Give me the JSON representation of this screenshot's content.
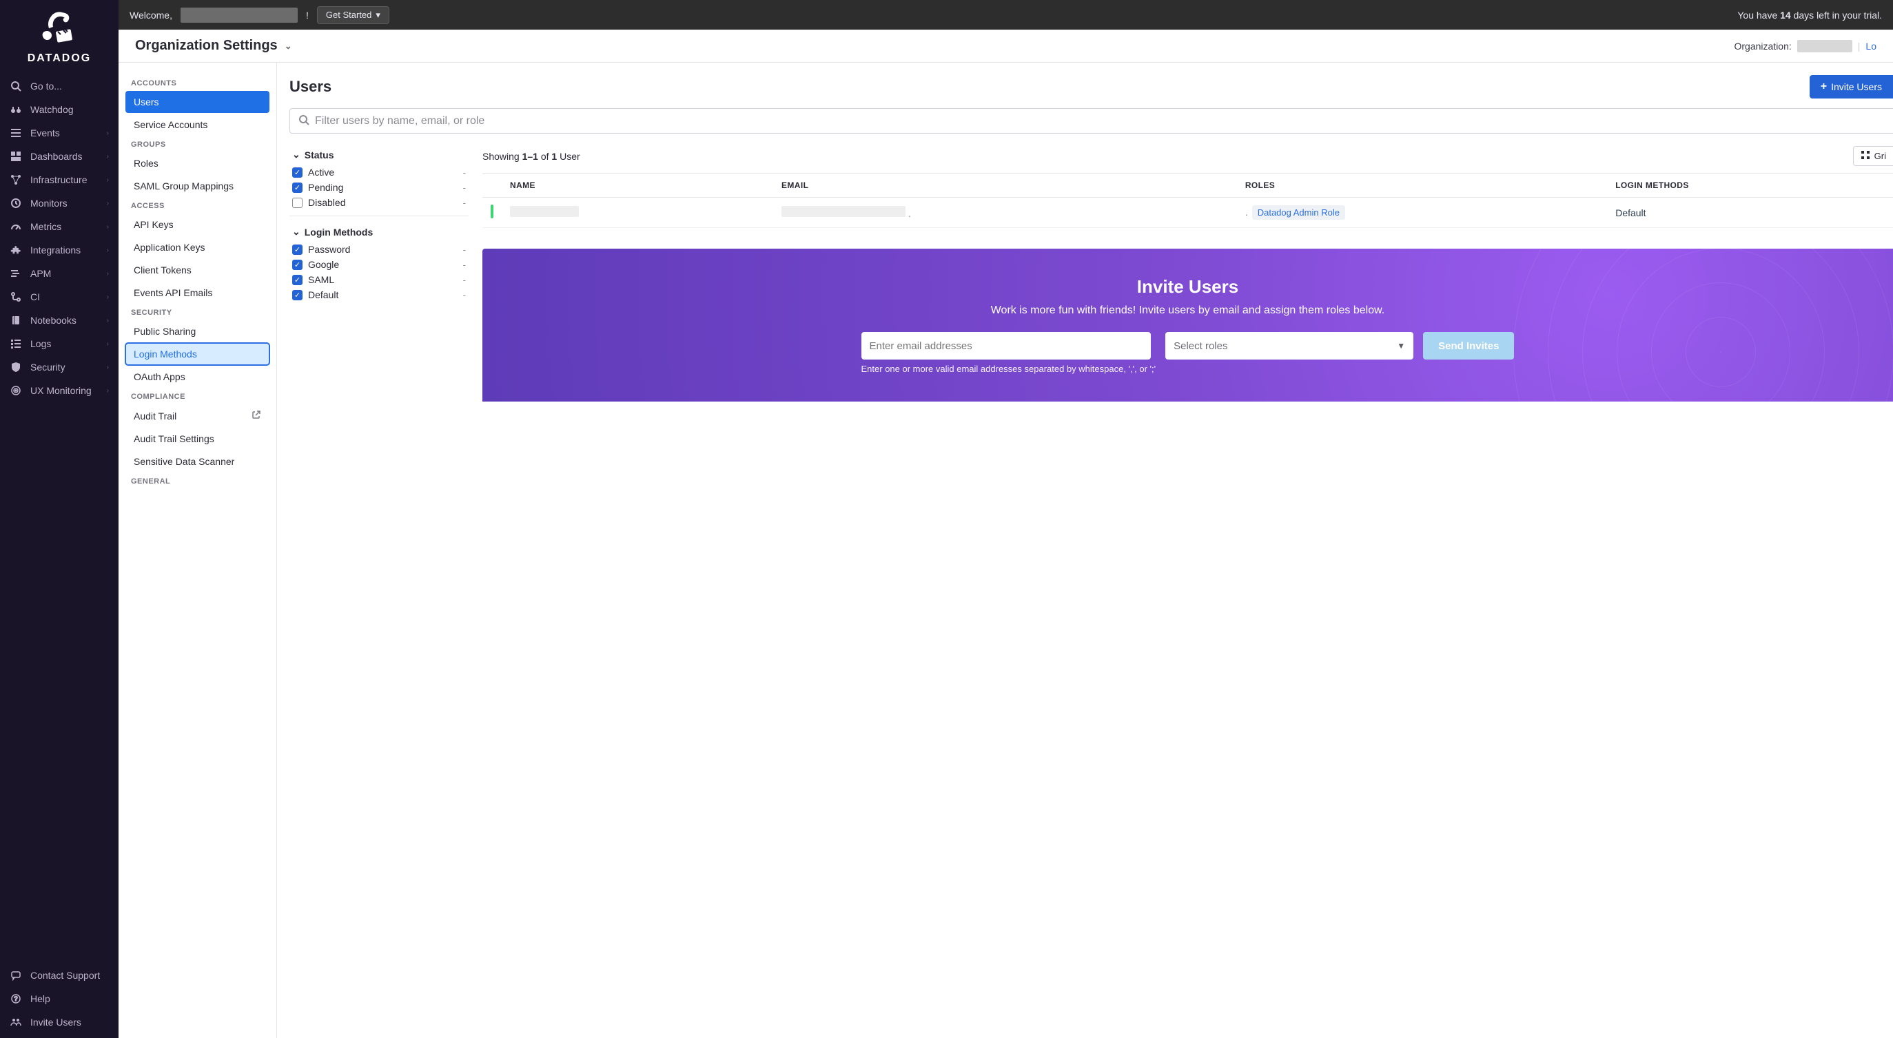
{
  "brand": {
    "name": "DATADOG"
  },
  "leftnav": {
    "goto": "Go to...",
    "items": [
      {
        "label": "Watchdog"
      },
      {
        "label": "Events"
      },
      {
        "label": "Dashboards"
      },
      {
        "label": "Infrastructure"
      },
      {
        "label": "Monitors"
      },
      {
        "label": "Metrics"
      },
      {
        "label": "Integrations"
      },
      {
        "label": "APM"
      },
      {
        "label": "CI"
      },
      {
        "label": "Notebooks"
      },
      {
        "label": "Logs"
      },
      {
        "label": "Security"
      },
      {
        "label": "UX Monitoring"
      }
    ],
    "footer": [
      {
        "label": "Contact Support"
      },
      {
        "label": "Help"
      },
      {
        "label": "Invite Users"
      }
    ]
  },
  "topbar": {
    "welcome_prefix": "Welcome,",
    "welcome_suffix": "!",
    "get_started": "Get Started",
    "trial_prefix": "You have ",
    "trial_days": "14",
    "trial_suffix": " days left in your trial."
  },
  "page": {
    "title": "Organization Settings",
    "org_label": "Organization:",
    "org_link_partial": "Lo"
  },
  "settings_sidebar": {
    "sections": [
      {
        "heading": "ACCOUNTS",
        "items": [
          {
            "label": "Users",
            "state": "active"
          },
          {
            "label": "Service Accounts"
          }
        ]
      },
      {
        "heading": "GROUPS",
        "items": [
          {
            "label": "Roles"
          },
          {
            "label": "SAML Group Mappings"
          }
        ]
      },
      {
        "heading": "ACCESS",
        "items": [
          {
            "label": "API Keys"
          },
          {
            "label": "Application Keys"
          },
          {
            "label": "Client Tokens"
          },
          {
            "label": "Events API Emails"
          }
        ]
      },
      {
        "heading": "SECURITY",
        "items": [
          {
            "label": "Public Sharing"
          },
          {
            "label": "Login Methods",
            "state": "highlighted"
          },
          {
            "label": "OAuth Apps"
          }
        ]
      },
      {
        "heading": "COMPLIANCE",
        "items": [
          {
            "label": "Audit Trail",
            "external": true
          },
          {
            "label": "Audit Trail Settings"
          },
          {
            "label": "Sensitive Data Scanner"
          }
        ]
      },
      {
        "heading": "GENERAL",
        "items": []
      }
    ]
  },
  "main": {
    "heading": "Users",
    "invite_btn": "Invite Users",
    "search_placeholder": "Filter users by name, email, or role",
    "filters": {
      "status": {
        "heading": "Status",
        "options": [
          {
            "label": "Active",
            "checked": true,
            "count": "-"
          },
          {
            "label": "Pending",
            "checked": true,
            "count": "-"
          },
          {
            "label": "Disabled",
            "checked": false,
            "count": "-"
          }
        ]
      },
      "login_methods": {
        "heading": "Login Methods",
        "options": [
          {
            "label": "Password",
            "checked": true,
            "count": "-"
          },
          {
            "label": "Google",
            "checked": true,
            "count": "-"
          },
          {
            "label": "SAML",
            "checked": true,
            "count": "-"
          },
          {
            "label": "Default",
            "checked": true,
            "count": "-"
          }
        ]
      }
    },
    "showing": {
      "prefix": "Showing ",
      "range": "1–1",
      "middle": " of ",
      "total": "1",
      "suffix": " User"
    },
    "grid_btn": "Gri",
    "table": {
      "columns": [
        "NAME",
        "EMAIL",
        "ROLES",
        "LOGIN METHODS"
      ],
      "rows": [
        {
          "role": "Datadog Admin Role",
          "login_method": "Default"
        }
      ]
    },
    "invite_panel": {
      "title": "Invite Users",
      "subtitle": "Work is more fun with friends! Invite users by email and assign them roles below.",
      "email_placeholder": "Enter email addresses",
      "roles_placeholder": "Select roles",
      "send_btn": "Send Invites",
      "hint": "Enter one or more valid email addresses separated by whitespace, ',', or ';'"
    }
  }
}
